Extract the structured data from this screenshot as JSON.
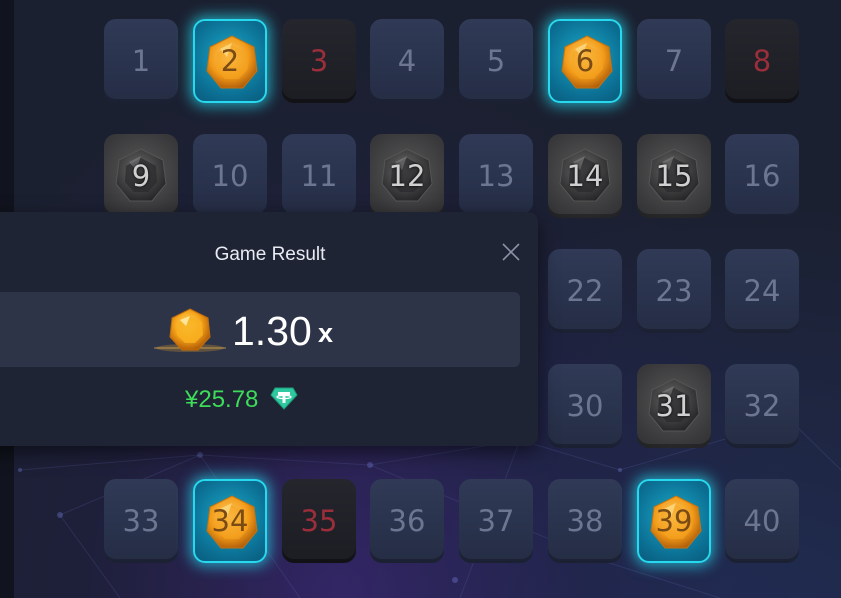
{
  "board": {
    "tiles": [
      {
        "n": "1",
        "state": "hidden"
      },
      {
        "n": "2",
        "state": "gem-gold"
      },
      {
        "n": "3",
        "state": "bomb"
      },
      {
        "n": "4",
        "state": "hidden"
      },
      {
        "n": "5",
        "state": "hidden"
      },
      {
        "n": "6",
        "state": "gem-gold"
      },
      {
        "n": "7",
        "state": "hidden"
      },
      {
        "n": "8",
        "state": "bomb"
      },
      {
        "n": "9",
        "state": "gem-dark"
      },
      {
        "n": "10",
        "state": "hidden"
      },
      {
        "n": "11",
        "state": "hidden"
      },
      {
        "n": "12",
        "state": "gem-dark"
      },
      {
        "n": "13",
        "state": "hidden"
      },
      {
        "n": "14",
        "state": "gem-dark"
      },
      {
        "n": "15",
        "state": "gem-dark"
      },
      {
        "n": "16",
        "state": "hidden"
      },
      {
        "n": "22",
        "state": "hidden"
      },
      {
        "n": "23",
        "state": "hidden"
      },
      {
        "n": "24",
        "state": "hidden"
      },
      {
        "n": "30",
        "state": "hidden"
      },
      {
        "n": "31",
        "state": "gem-dark"
      },
      {
        "n": "32",
        "state": "hidden"
      },
      {
        "n": "33",
        "state": "hidden"
      },
      {
        "n": "34",
        "state": "gem-gold"
      },
      {
        "n": "35",
        "state": "bomb"
      },
      {
        "n": "36",
        "state": "hidden"
      },
      {
        "n": "37",
        "state": "hidden"
      },
      {
        "n": "38",
        "state": "hidden"
      },
      {
        "n": "39",
        "state": "gem-gold"
      },
      {
        "n": "40",
        "state": "hidden"
      }
    ]
  },
  "result": {
    "title": "Game Result",
    "multiplier": "1.30",
    "multiplier_suffix": "x",
    "payout": "¥25.78",
    "currency_icon": "usdt-tether-icon",
    "close_icon": "close-icon"
  },
  "colors": {
    "tile_hidden": "#2b3450",
    "gem_gold_border": "#27d8ee",
    "bomb_number": "#9a2e3a",
    "payout_green": "#3ddc59"
  }
}
